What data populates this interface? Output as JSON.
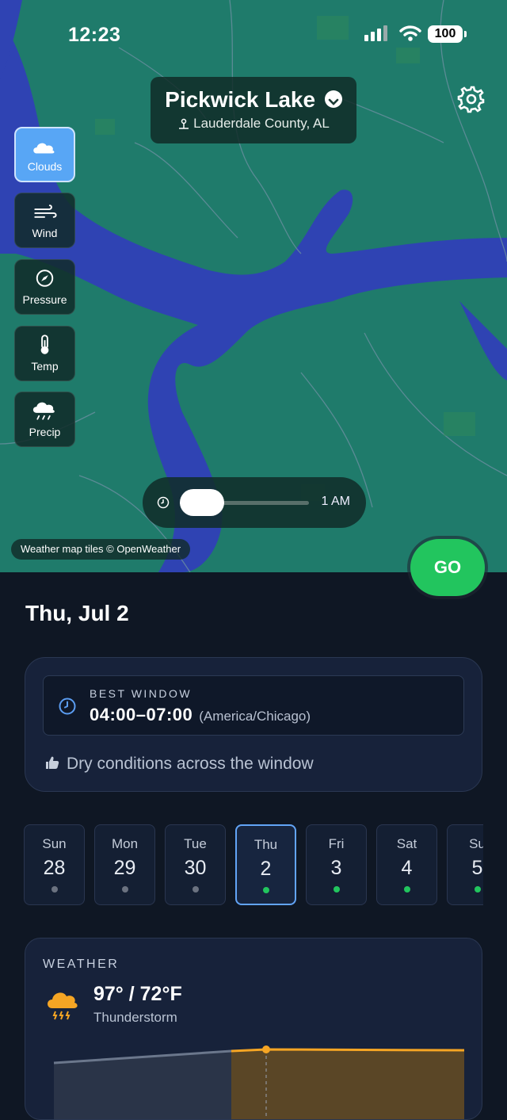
{
  "status_bar": {
    "time": "12:23",
    "battery": "100"
  },
  "location": {
    "name": "Pickwick Lake",
    "region": "Lauderdale County, AL"
  },
  "layers": [
    {
      "label": "Clouds",
      "icon": "cloud-icon",
      "active": true
    },
    {
      "label": "Wind",
      "icon": "wind-icon",
      "active": false
    },
    {
      "label": "Pressure",
      "icon": "compass-icon",
      "active": false
    },
    {
      "label": "Temp",
      "icon": "thermometer-icon",
      "active": false
    },
    {
      "label": "Precip",
      "icon": "rain-cloud-icon",
      "active": false
    }
  ],
  "time_slider": {
    "hour_label": "1 AM",
    "position": 0.1
  },
  "attribution": "Weather map tiles © OpenWeather",
  "go_button": "GO",
  "selected_date": "Thu, Jul 2",
  "best_window": {
    "label": "BEST WINDOW",
    "time": "04:00–07:00",
    "timezone": "(America/Chicago)",
    "note": "Dry conditions across the window"
  },
  "days": [
    {
      "name": "Sun",
      "num": "28",
      "dot": "#6b7280",
      "selected": false
    },
    {
      "name": "Mon",
      "num": "29",
      "dot": "#6b7280",
      "selected": false
    },
    {
      "name": "Tue",
      "num": "30",
      "dot": "#6b7280",
      "selected": false
    },
    {
      "name": "Thu",
      "num": "2",
      "dot": "#22c55e",
      "selected": true
    },
    {
      "name": "Fri",
      "num": "3",
      "dot": "#22c55e",
      "selected": false
    },
    {
      "name": "Sat",
      "num": "4",
      "dot": "#22c55e",
      "selected": false
    },
    {
      "name": "Su",
      "num": "5",
      "dot": "#22c55e",
      "selected": false
    }
  ],
  "weather": {
    "label": "WEATHER",
    "temp": "97° / 72°F",
    "condition": "Thunderstorm",
    "icon": "thunderstorm-icon",
    "accent": "#f5a524"
  }
}
